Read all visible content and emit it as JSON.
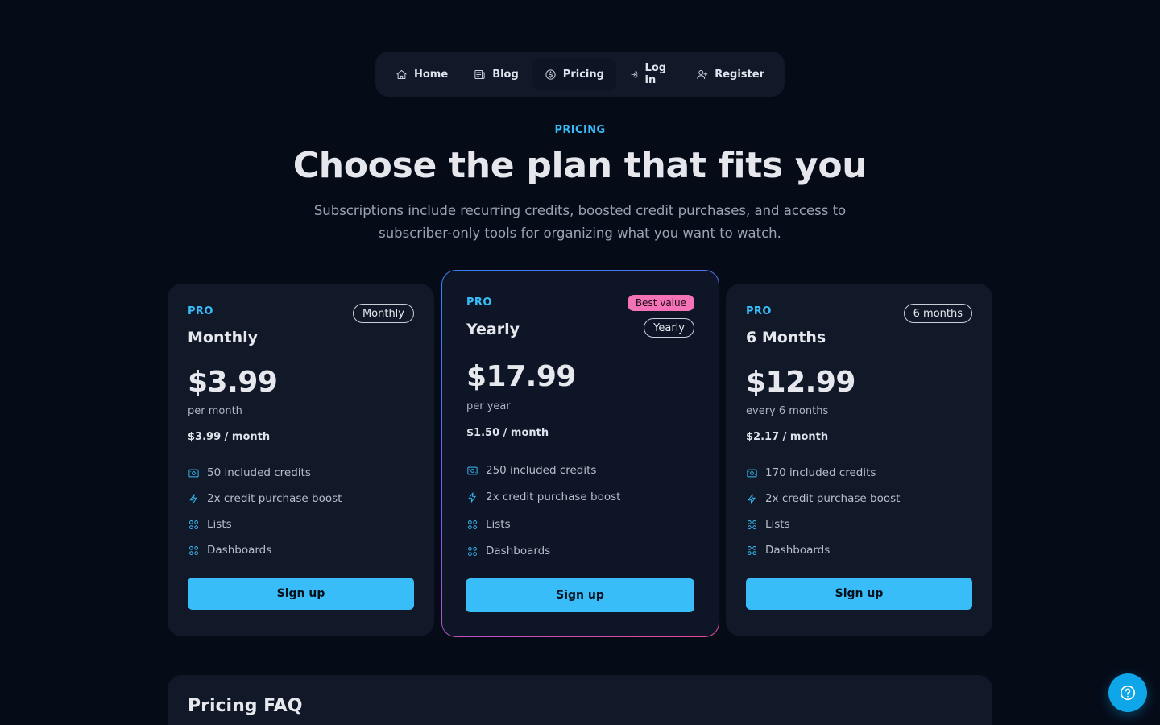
{
  "nav": {
    "items": [
      {
        "label": "Home",
        "icon": "home-icon"
      },
      {
        "label": "Blog",
        "icon": "newspaper-icon"
      },
      {
        "label": "Pricing",
        "icon": "dollar-icon",
        "active": true
      },
      {
        "label": "Log in",
        "icon": "login-icon"
      },
      {
        "label": "Register",
        "icon": "user-plus-icon"
      }
    ]
  },
  "header": {
    "eyebrow": "PRICING",
    "title": "Choose the plan that fits you",
    "subtitle": "Subscriptions include recurring credits, boosted credit purchases, and access to subscriber-only tools for organizing what you want to watch."
  },
  "plans": [
    {
      "tier": "PRO",
      "name": "Monthly",
      "pill": "Monthly",
      "price": "$3.99",
      "period": "per month",
      "monthly": "$3.99 / month",
      "features": [
        "50 included credits",
        "2x credit purchase boost",
        "Lists",
        "Dashboards"
      ],
      "cta": "Sign up"
    },
    {
      "tier": "PRO",
      "name": "Yearly",
      "badge": "Best value",
      "pill": "Yearly",
      "price": "$17.99",
      "period": "per year",
      "monthly": "$1.50 / month",
      "features": [
        "250 included credits",
        "2x credit purchase boost",
        "Lists",
        "Dashboards"
      ],
      "cta": "Sign up"
    },
    {
      "tier": "PRO",
      "name": "6 Months",
      "pill": "6 months",
      "price": "$12.99",
      "period": "every 6 months",
      "monthly": "$2.17 / month",
      "features": [
        "170 included credits",
        "2x credit purchase boost",
        "Lists",
        "Dashboards"
      ],
      "cta": "Sign up"
    }
  ],
  "faq": {
    "title": "Pricing FAQ"
  },
  "colors": {
    "background": "#060b18",
    "card": "#111827",
    "accent": "#38bdf8",
    "badge": "#f472b6"
  }
}
